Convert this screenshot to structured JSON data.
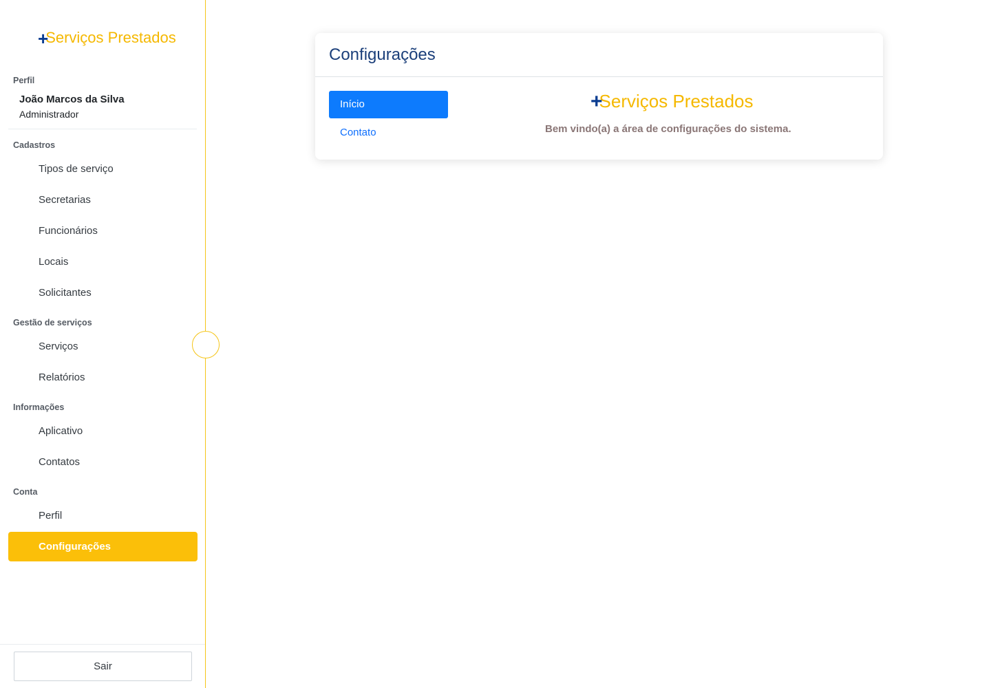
{
  "sidebar": {
    "brand": {
      "plus": "+",
      "text": "Serviços Prestados"
    },
    "profile": {
      "section_label": "Perfil",
      "name": "João Marcos da Silva",
      "role": "Administrador"
    },
    "sections": {
      "cadastros": {
        "label": "Cadastros",
        "items": [
          "Tipos de serviço",
          "Secretarias",
          "Funcionários",
          "Locais",
          "Solicitantes"
        ]
      },
      "gestao": {
        "label": "Gestão de serviços",
        "items": [
          "Serviços",
          "Relatórios"
        ]
      },
      "informacoes": {
        "label": "Informações",
        "items": [
          "Aplicativo",
          "Contatos"
        ]
      },
      "conta": {
        "label": "Conta",
        "items": [
          "Perfil",
          "Configurações"
        ],
        "active_index": 1
      }
    },
    "logout_label": "Sair"
  },
  "main": {
    "title": "Configurações",
    "tabs": [
      "Início",
      "Contato"
    ],
    "active_tab_index": 0,
    "brand": {
      "plus": "+",
      "text": "Serviços Prestados"
    },
    "welcome": "Bem vindo(a) a área de configurações do sistema."
  },
  "colors": {
    "brand_yellow": "#f5b800",
    "brand_blue": "#0b3d91",
    "active_nav": "#fbbf09",
    "active_tab": "#0d7bfd",
    "title_blue": "#1b3f7a"
  }
}
